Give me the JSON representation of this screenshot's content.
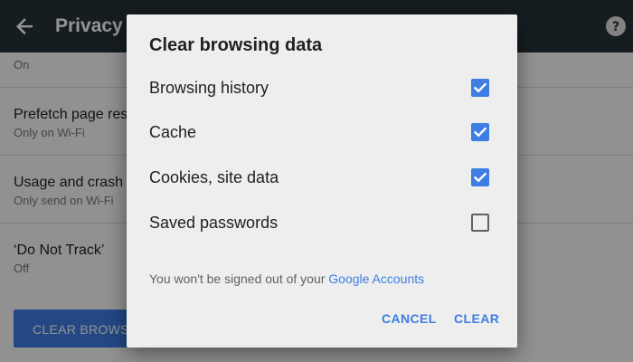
{
  "colors": {
    "toolbar": "#263238",
    "accent": "#3d7de4",
    "dialog_bg": "#eeeeee",
    "scrim": "rgba(0,0,0,0.42)"
  },
  "toolbar": {
    "back_icon": "arrow-back-icon",
    "title": "Privacy",
    "help_icon": "help-icon"
  },
  "settings": {
    "top_subtitle": "On",
    "rows": [
      {
        "title": "Prefetch page res",
        "subtitle": "Only on Wi-Fi"
      },
      {
        "title": "Usage and crash",
        "subtitle": "Only send on Wi-Fi"
      },
      {
        "title": "‘Do Not Track’",
        "subtitle": "Off"
      }
    ],
    "clear_button_label": "CLEAR BROWSI"
  },
  "dialog": {
    "title": "Clear browsing data",
    "options": [
      {
        "label": "Browsing history",
        "checked": true
      },
      {
        "label": "Cache",
        "checked": true
      },
      {
        "label": "Cookies, site data",
        "checked": true
      },
      {
        "label": "Saved passwords",
        "checked": false
      }
    ],
    "note": "You won't be signed out of your ",
    "note_link": "Google Accounts",
    "cancel_label": "CANCEL",
    "clear_label": "CLEAR"
  }
}
